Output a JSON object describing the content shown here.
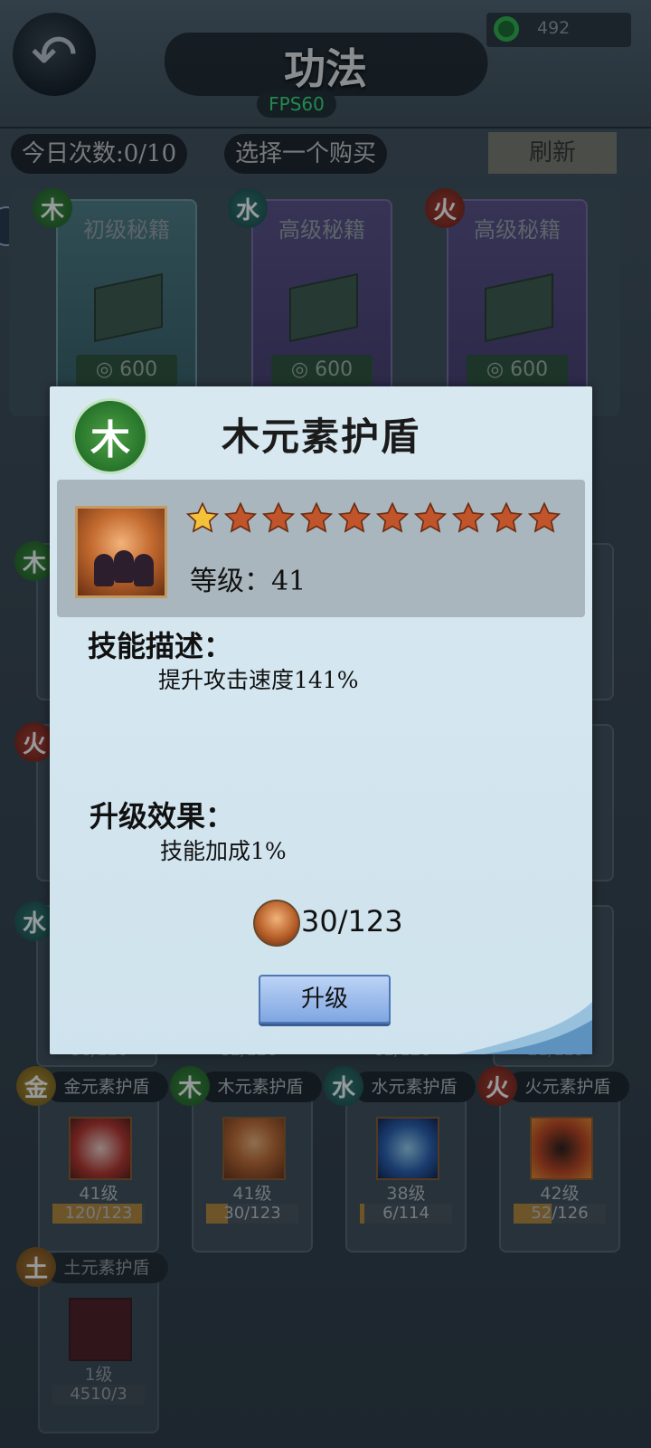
{
  "header": {
    "title": "功法",
    "fps": "FPS60",
    "currency_value": "492"
  },
  "shop": {
    "daily_count": "今日次数:0/10",
    "select_hint": "选择一个购买",
    "refresh_label": "刷新",
    "books": [
      {
        "element": "木",
        "name": "初级秘籍",
        "price": "600",
        "color": "#4e7c84"
      },
      {
        "element": "水",
        "name": "高级秘籍",
        "price": "600",
        "color": "#5b4f86"
      },
      {
        "element": "火",
        "name": "高级秘籍",
        "price": "600",
        "color": "#5b4f86"
      }
    ]
  },
  "skill_grid": {
    "row3": {
      "bars": [
        "90/120",
        "82/126",
        "82/126",
        "21/129"
      ]
    },
    "row4": [
      {
        "element": "金",
        "name": "金元素护盾",
        "level": "41级",
        "progress": "120/123",
        "fill_fraction": 0.97
      },
      {
        "element": "木",
        "name": "木元素护盾",
        "level": "41级",
        "progress": "30/123",
        "fill_fraction": 0.24
      },
      {
        "element": "水",
        "name": "水元素护盾",
        "level": "38级",
        "progress": "6/114",
        "fill_fraction": 0.05
      },
      {
        "element": "火",
        "name": "火元素护盾",
        "level": "42级",
        "progress": "52/126",
        "fill_fraction": 0.41
      }
    ],
    "row5": [
      {
        "element": "土",
        "name": "土元素护盾",
        "level": "1级",
        "progress": "4510/3"
      }
    ]
  },
  "modal": {
    "element": "木",
    "title": "木元素护盾",
    "stars_total": 10,
    "stars_lit": 1,
    "level_label": "等级：41",
    "description_heading": "技能描述：",
    "description": "提升攻击速度141%",
    "effect_heading": "升级效果：",
    "effect": "技能加成1%",
    "cost": "30/123",
    "upgrade_label": "升级",
    "colors": {
      "star_lit": "#f2c23a",
      "star_dim": "#c0542a",
      "button": "#9cbcec"
    }
  }
}
